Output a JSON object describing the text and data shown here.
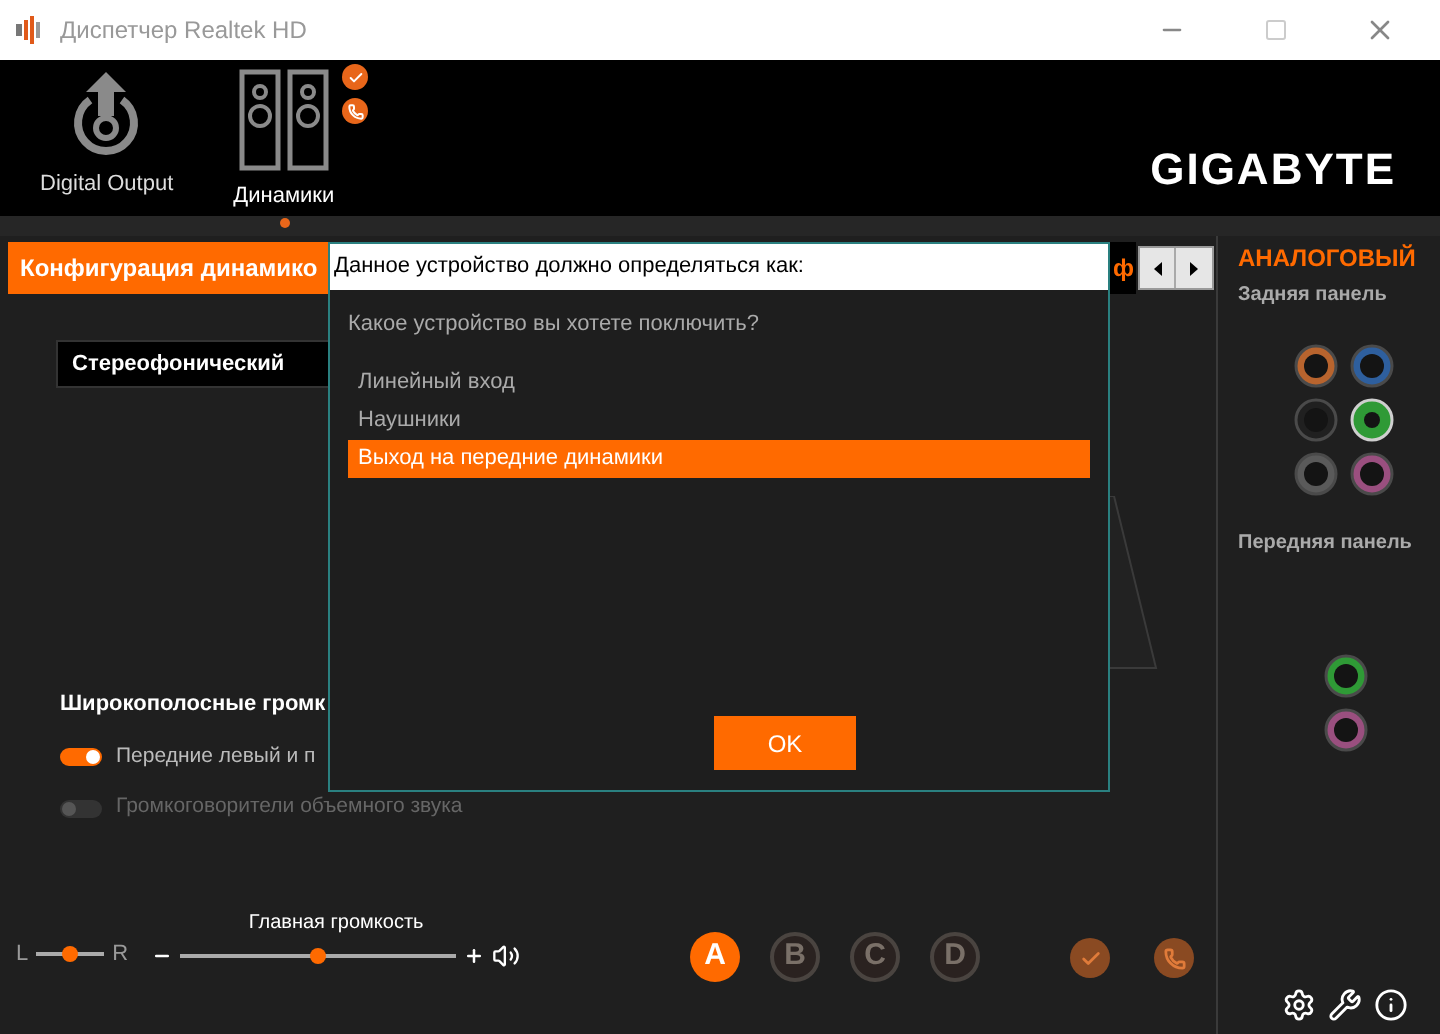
{
  "window": {
    "title": "Диспетчер Realtek HD"
  },
  "brand": {
    "logo": "GIGABYTE"
  },
  "devices": [
    {
      "label": "Digital Output",
      "kind": "digital",
      "selected": false
    },
    {
      "label": "Динамики",
      "kind": "speakers",
      "selected": true
    }
  ],
  "device_badges": [
    {
      "kind": "check"
    },
    {
      "kind": "phone"
    }
  ],
  "tabs": [
    {
      "label": "Конфигурация динамико",
      "selected": true
    },
    {
      "label": "ф",
      "selected": false
    }
  ],
  "speaker_config": {
    "value": "Стереофонический"
  },
  "fullrange": {
    "title": "Широкополосные громк",
    "options": [
      {
        "label": "Передние левый и п",
        "on": true
      },
      {
        "label": "Громкоговорители объемного звука",
        "on": false
      }
    ]
  },
  "balance": {
    "left": "L",
    "right": "R",
    "level": 0.5
  },
  "main_volume": {
    "label": "Главная громкость",
    "level": 0.5
  },
  "profiles": [
    {
      "label": "A",
      "selected": true
    },
    {
      "label": "B",
      "selected": false
    },
    {
      "label": "C",
      "selected": false
    },
    {
      "label": "D",
      "selected": false
    }
  ],
  "status_buttons": [
    {
      "kind": "check"
    },
    {
      "kind": "phone"
    }
  ],
  "dialog": {
    "title": "Данное устройство должно определяться как:",
    "question": "Какое устройство вы хотете поключить?",
    "options": [
      {
        "label": "Линейный вход",
        "selected": false
      },
      {
        "label": "Наушники",
        "selected": false
      },
      {
        "label": "Выход на передние динамики",
        "selected": true
      }
    ],
    "ok": "OK"
  },
  "analog": {
    "title": "АНАЛОГОВЫЙ",
    "rear": {
      "label": "Задняя панель",
      "jacks": [
        {
          "color": "#b8642e",
          "active": false
        },
        {
          "color": "#2e5f9e",
          "active": false
        },
        {
          "color": "#202020",
          "active": false
        },
        {
          "color": "#2f9a36",
          "active": true
        },
        {
          "color": "#5a5a5a",
          "active": false
        },
        {
          "color": "#9a4f7f",
          "active": false
        }
      ]
    },
    "front": {
      "label": "Передняя панель",
      "jacks": [
        {
          "color": "#2f9a36",
          "active": false
        },
        {
          "color": "#9a4f7f",
          "active": false
        }
      ]
    }
  }
}
